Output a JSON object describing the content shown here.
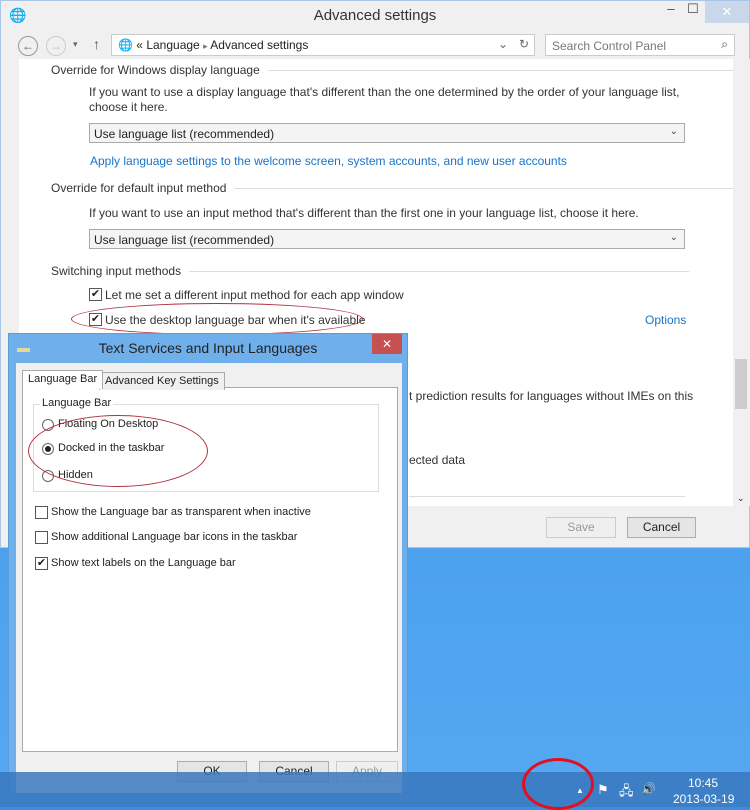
{
  "window": {
    "title": "Advanced settings",
    "minimize": "–",
    "maximize": "☐",
    "close": "✕"
  },
  "nav": {
    "back": "←",
    "forward": "→",
    "recent": "▾",
    "up": "↑",
    "breadcrumb": [
      "«",
      "Language",
      "▸",
      "Advanced settings"
    ],
    "refresh": "↻",
    "dropdown": "⌄",
    "search_placeholder": "Search Control Panel",
    "search_icon": "⌕"
  },
  "content": {
    "s1_heading": "Override for Windows display language",
    "s1_text": "If you want to use a display language that's different than the one determined by the order of your language list, choose it here.",
    "s1_select": "Use language list (recommended)",
    "s1_link": "Apply language settings to the welcome screen, system accounts, and new user accounts",
    "s2_heading": "Override for default input method",
    "s2_text": "If you want to use an input method that's different than the first one in your language list, choose it here.",
    "s2_select": "Use language list (recommended)",
    "s3_heading": "Switching input methods",
    "cb1": {
      "label": "Let me set a different input method for each app window",
      "checked": true
    },
    "cb2": {
      "label": "Use the desktop language bar when it's available",
      "checked": true
    },
    "options_link": "Options",
    "partial1": "t prediction results for languages without IMEs on this",
    "partial2": "ected data"
  },
  "footer": {
    "save": "Save",
    "cancel": "Cancel"
  },
  "dialog": {
    "title": "Text Services and Input Languages",
    "close": "✕",
    "tabs": [
      "Language Bar",
      "Advanced Key Settings"
    ],
    "group": "Language Bar",
    "radios": [
      {
        "label": "Floating On Desktop",
        "selected": false
      },
      {
        "label": "Docked in the taskbar",
        "selected": true
      },
      {
        "label": "Hidden",
        "selected": false
      }
    ],
    "checks": [
      {
        "label": "Show the Language bar as transparent when inactive",
        "checked": false
      },
      {
        "label": "Show additional Language bar icons in the taskbar",
        "checked": false
      },
      {
        "label": "Show text labels on the Language bar",
        "checked": true
      }
    ],
    "ok": "OK",
    "cancel": "Cancel",
    "apply": "Apply"
  },
  "taskbar": {
    "show_hidden": "▲",
    "flag": "⚑",
    "network": "🖧",
    "volume": "🔊",
    "time": "10:45",
    "date": "2013-03-19"
  },
  "check_mark": "✔"
}
